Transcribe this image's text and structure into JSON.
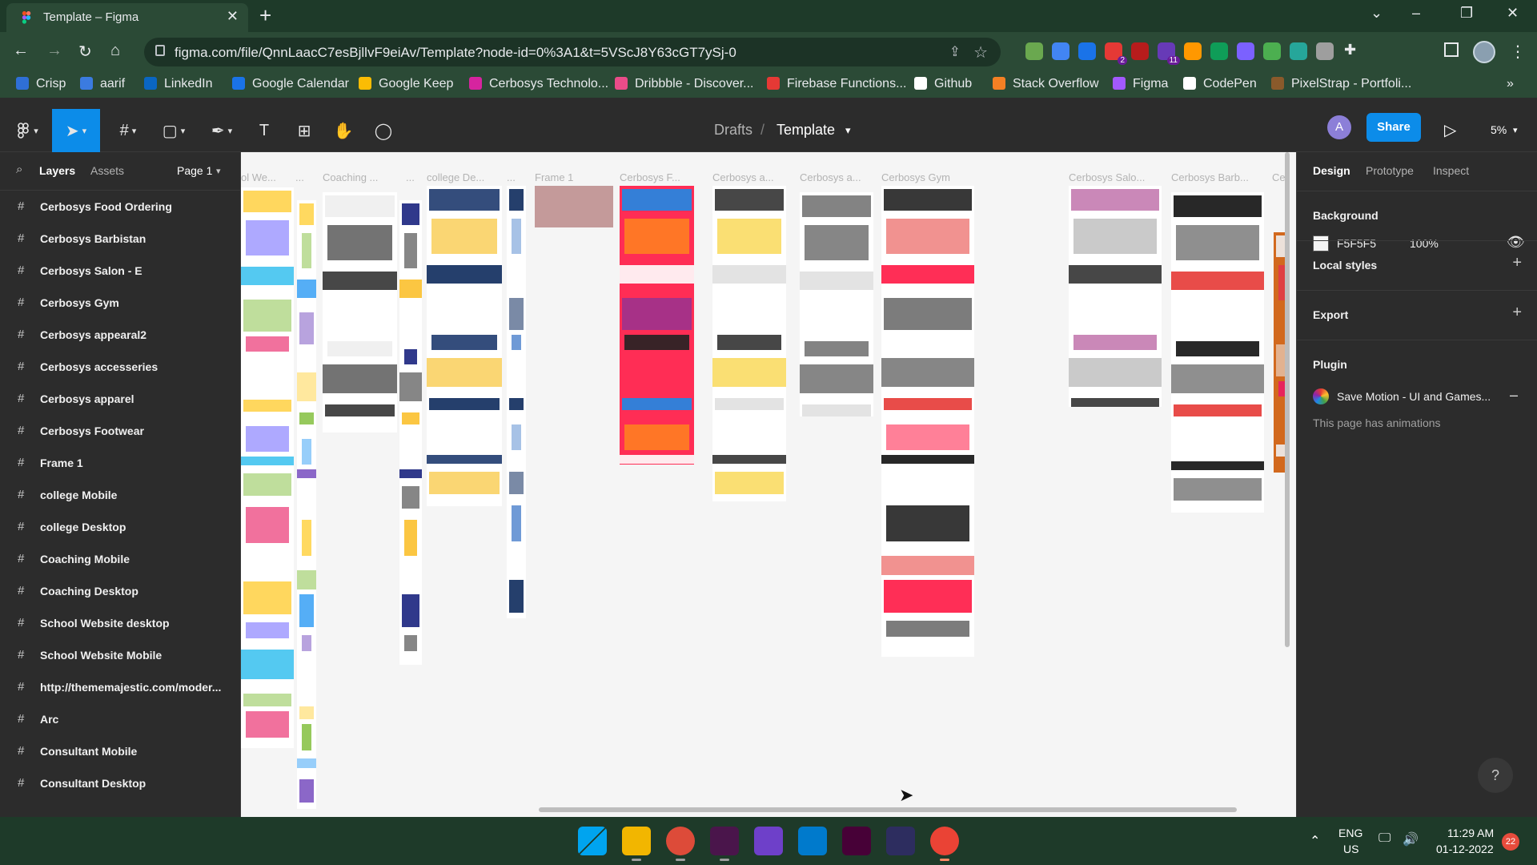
{
  "browser": {
    "tab_title": "Template – Figma",
    "url": "figma.com/file/QnnLaacC7esBjllvF9eiAv/Template?node-id=0%3A1&t=5VScJ8Y63cGT7ySj-0",
    "bookmarks": [
      "Crisp",
      "aarif",
      "LinkedIn",
      "Google Calendar",
      "Google Keep",
      "Cerbosys Technolo...",
      "Dribbble - Discover...",
      "Firebase Functions...",
      "Github",
      "Stack Overflow",
      "Figma",
      "CodePen",
      "PixelStrap - Portfoli..."
    ],
    "bookmark_colors": [
      "#2f6fd6",
      "#3b7be0",
      "#0a66c2",
      "#1a73e8",
      "#fbbc04",
      "#d6249f",
      "#ea4c89",
      "#e53935",
      "#ffffff",
      "#f48024",
      "#a259ff",
      "#ffffff",
      "#8a5a2b"
    ],
    "extension_colors": [
      "#6aa84f",
      "#4285f4",
      "#1a73e8",
      "#e53935",
      "#b71c1c",
      "#673ab7",
      "#ff9800",
      "#0f9d58",
      "#7b61ff",
      "#4caf50",
      "#26a69a",
      "#9e9e9e"
    ],
    "extension_badges": {
      "e3": "2",
      "e5": "11"
    }
  },
  "figma": {
    "breadcrumb_parent": "Drafts",
    "breadcrumb_sep": "/",
    "file_name": "Template",
    "user_initial": "A",
    "share_label": "Share",
    "zoom": "5%",
    "left_tabs": {
      "layers": "Layers",
      "assets": "Assets",
      "page": "Page 1"
    },
    "layers": [
      "Cerbosys Food Ordering",
      "Cerbosys Barbistan",
      "Cerbosys Salon - E",
      "Cerbosys Gym",
      "Cerbosys appearal2",
      "Cerbosys accesseries",
      "Cerbosys apparel",
      "Cerbosys Footwear",
      "Frame 1",
      "college Mobile",
      "college Desktop",
      "Coaching Mobile",
      "Coaching Desktop",
      "School Website desktop",
      "School Website Mobile",
      "http://thememajestic.com/moder...",
      "Arc",
      "Consultant Mobile",
      "Consultant Desktop"
    ],
    "canvas_labels": [
      "ol We...",
      "...",
      "Coaching ...",
      "...",
      "college De...",
      "...",
      "Frame 1",
      "Cerbosys F...",
      "Cerbosys a...",
      "Cerbosys a...",
      "Cerbosys Gym",
      "Cerbosys Salo...",
      "Cerbosys Barb...",
      "Ce"
    ],
    "right_tabs": {
      "design": "Design",
      "prototype": "Prototype",
      "inspect": "Inspect"
    },
    "background": {
      "title": "Background",
      "hex": "F5F5F5",
      "opacity": "100%"
    },
    "local_styles": "Local styles",
    "export": "Export",
    "plugin": {
      "title": "Plugin",
      "name": "Save Motion - UI and Games...",
      "note": "This page has animations"
    },
    "help": "?"
  },
  "taskbar": {
    "lang": "ENG",
    "region": "US",
    "time": "11:29 AM",
    "date": "01-12-2022",
    "notif_count": "22",
    "app_colors": [
      "#0078d4",
      "#f2b600",
      "#dd4b39",
      "#4a154b",
      "#6e40c9",
      "#007acc",
      "#470137",
      "#2d2d5f",
      "#ea4335"
    ],
    "app_names": [
      "windows-start-icon",
      "file-explorer-icon",
      "chrome-icon",
      "slack-icon",
      "github-desktop-icon",
      "vscode-icon",
      "adobe-xd-icon",
      "app-icon",
      "chrome-active-icon"
    ]
  }
}
